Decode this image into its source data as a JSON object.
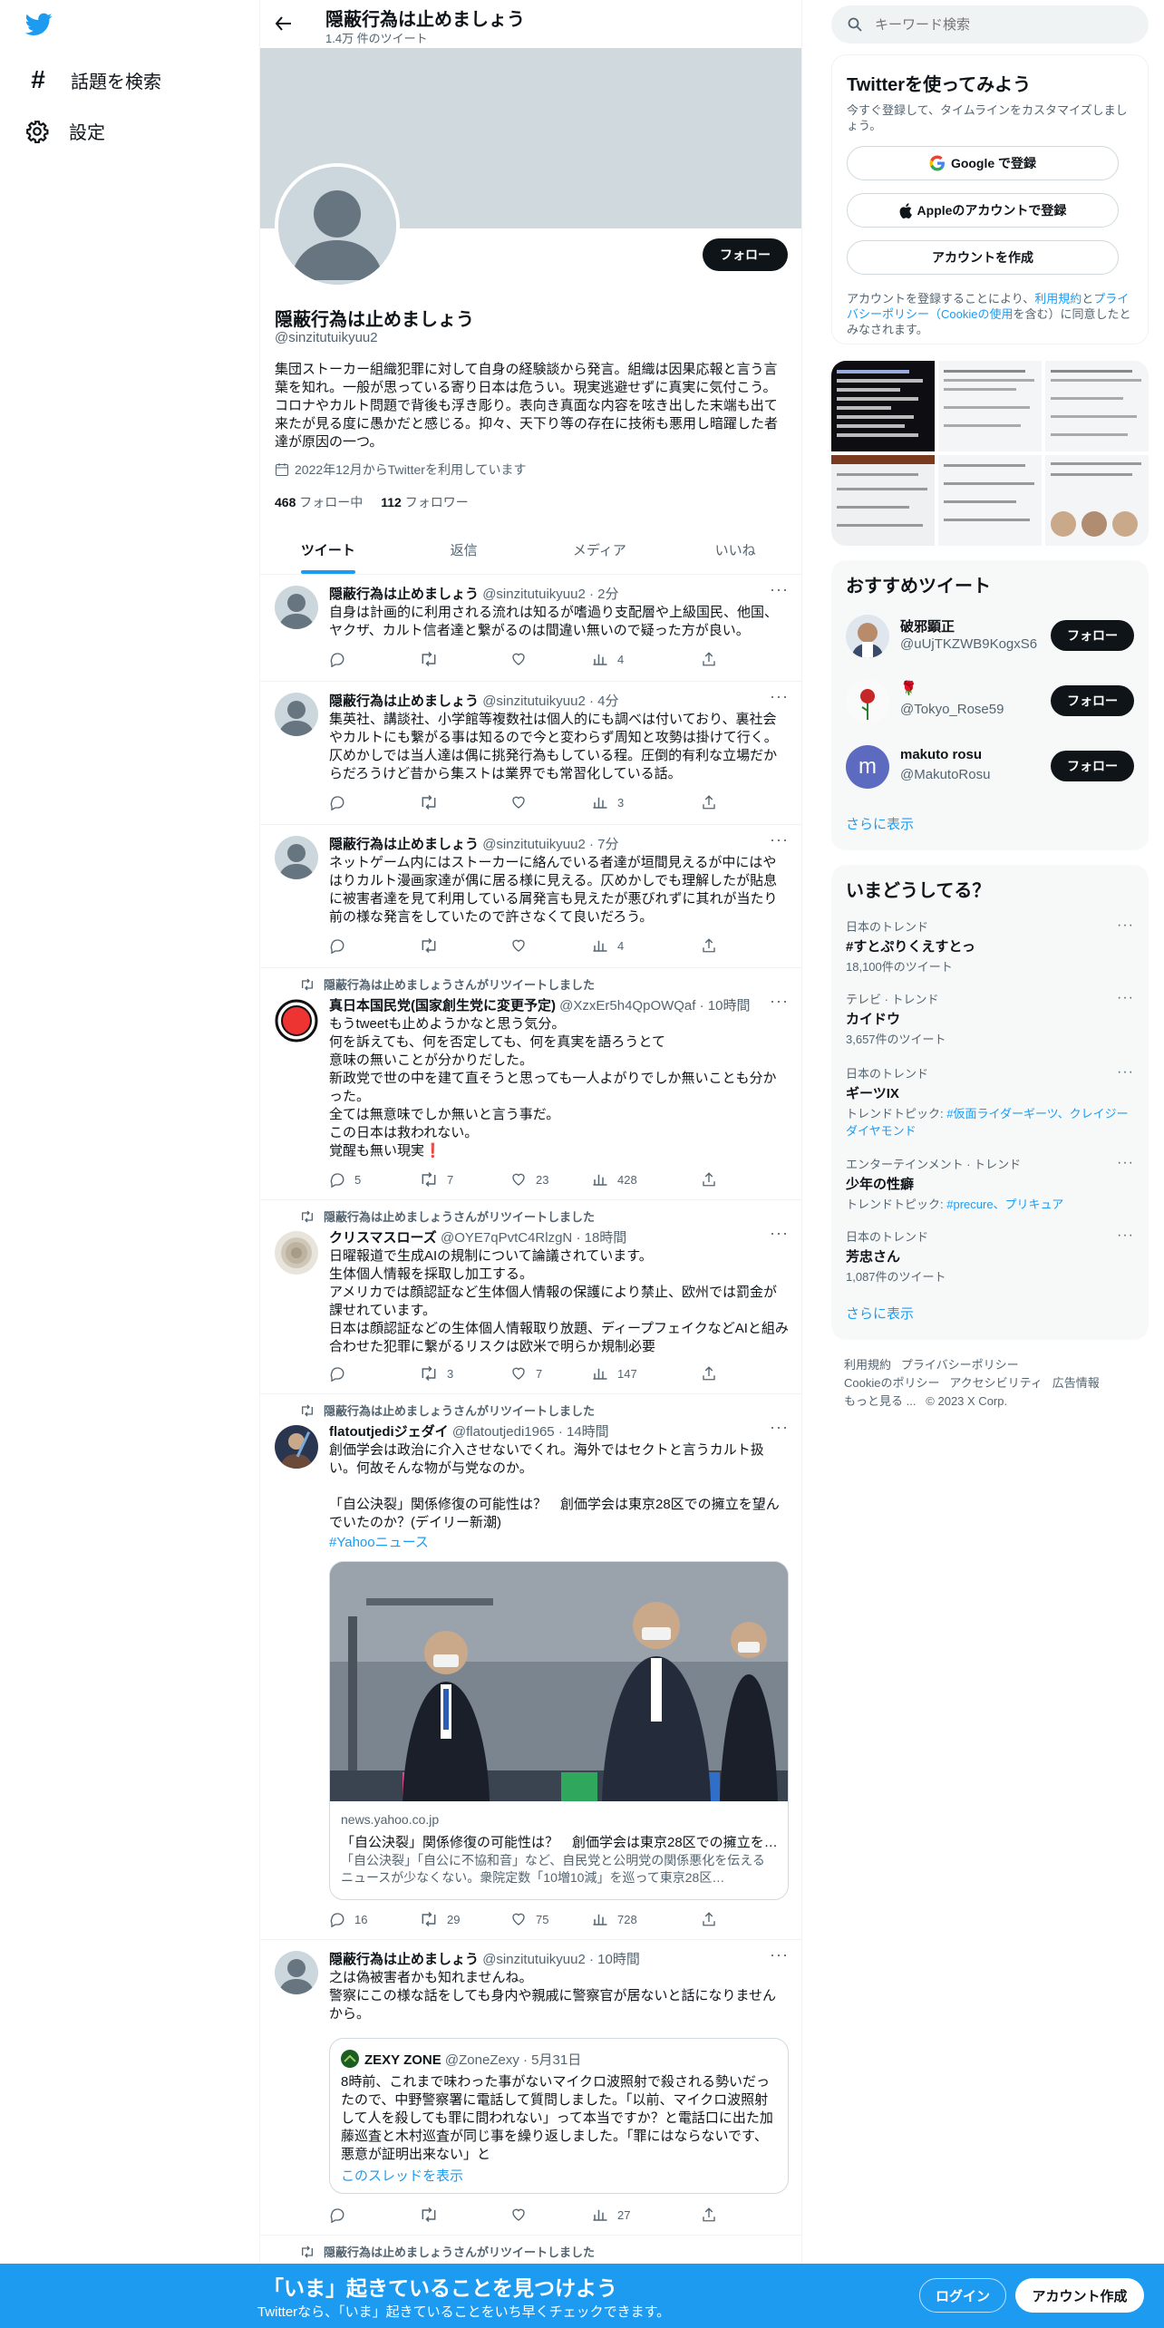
{
  "colors": {
    "accent": "#1d9bf0",
    "text": "#0f1419",
    "muted": "#536471",
    "banner": "#cfd9de"
  },
  "nav": {
    "logo": "twitter-bird-icon",
    "items": [
      {
        "label": "話題を検索",
        "icon": "hashtag-icon"
      },
      {
        "label": "設定",
        "icon": "gear-icon"
      }
    ]
  },
  "header": {
    "title": "隠蔽行為は止めましょう",
    "count": "1.4万 件のツイート"
  },
  "profile": {
    "name": "隠蔽行為は止めましょう",
    "handle": "@sinzitutuikyuu2",
    "follow_label": "フォロー",
    "bio": "集団ストーカー組織犯罪に対して自身の経験談から発言。組織は因果応報と言う言葉を知れ。一般が思っている寄り日本は危うい。現実逃避せずに真実に気付こう。コロナやカルト問題で背後も浮き彫り。表向き真面な内容を呟き出した末端も出て来たが見る度に愚かだと感じる。抑々、天下り等の存在に技術も悪用し暗躍した者達が原因の一つ。",
    "joined": "2022年12月からTwitterを利用しています",
    "following_count": "468",
    "following_label": "フォロー中",
    "followers_count": "112",
    "followers_label": "フォロワー"
  },
  "tabs": [
    {
      "label": "ツイート",
      "active": true
    },
    {
      "label": "返信"
    },
    {
      "label": "メディア"
    },
    {
      "label": "いいね"
    }
  ],
  "tweets": [
    {
      "name": "隠蔽行為は止めましょう",
      "handle": "@sinzitutuikyuu2",
      "time": "· 2分",
      "text": "自身は計画的に利用される流れは知るが嗜過り支配層や上級国民、他国、ヤクザ、カルト信者達と繋がるのは間違い無いので疑った方が良い。",
      "replies": "",
      "retweets": "",
      "likes": "",
      "views": "4"
    },
    {
      "name": "隠蔽行為は止めましょう",
      "handle": "@sinzitutuikyuu2",
      "time": "· 4分",
      "text": "集英社、講談社、小学館等複数社は個人的にも調べは付いており、裏社会やカルトにも繋がる事は知るので今と変わらず周知と攻勢は掛けて行く。仄めかしでは当人達は偶に挑発行為もしている程。圧倒的有利な立場だからだろうけど昔から集ストは業界でも常習化している話。",
      "replies": "",
      "retweets": "",
      "likes": "",
      "views": "3"
    },
    {
      "name": "隠蔽行為は止めましょう",
      "handle": "@sinzitutuikyuu2",
      "time": "· 7分",
      "text": "ネットゲーム内にはストーカーに絡んでいる者達が垣間見えるが中にはやはりカルト漫画家達が偶に居る様に見える。仄めかしでも理解したが貼息に被害者達を見て利用している屑発言も見えたが悪びれずに其れが当たり前の様な発言をしていたので許さなくて良いだろう。",
      "replies": "",
      "retweets": "",
      "likes": "",
      "views": "4"
    },
    {
      "retweeted_by": "隠蔽行為は止めましょうさんがリツイートしました",
      "name": "真日本国民党(国家創生党に変更予定)",
      "handle": "@XzxEr5h4QpOWQaf",
      "time": "· 10時間",
      "text": "もうtweetも止めようかなと思う気分。\n何を訴えても、何を否定しても、何を真実を語ろうとて\n意味の無いことが分かりだした。\n新政党で世の中を建て直そうと思っても一人よがりでしか無いことも分かった。\n全ては無意味でしか無いと言う事だ。\nこの日本は救われない。\n覚醒も無い現実❗",
      "replies": "5",
      "retweets": "7",
      "likes": "23",
      "views": "428"
    },
    {
      "retweeted_by": "隠蔽行為は止めましょうさんがリツイートしました",
      "name": "クリスマスローズ",
      "handle": "@OYE7qPvtC4RlzgN",
      "time": "· 18時間",
      "text": "日曜報道で生成AIの規制について論議されています。\n生体個人情報を採取し加工する。\nアメリカでは顔認証など生体個人情報の保護により禁止、欧州では罰金が課せれています。\n日本は顔認証などの生体個人情報取り放題、ディープフェイクなどAIと組み合わせた犯罪に繋がるリスクは欧米で明らか規制必要",
      "replies": "",
      "retweets": "3",
      "likes": "7",
      "views": "147"
    },
    {
      "retweeted_by": "隠蔽行為は止めましょうさんがリツイートしました",
      "name": "flatoutjediジェダイ",
      "handle": "@flatoutjedi1965",
      "time": "· 14時間",
      "text": "創価学会は政治に介入させないでくれ。海外ではセクトと言うカルト扱い。何故そんな物が与党なのか。\n\n「自公決裂」関係修復の可能性は？　創価学会は東京28区での擁立を望んでいたのか？(デイリー新潮)",
      "hashtag": "#Yahooニュース",
      "card": {
        "domain": "news.yahoo.co.jp",
        "title": "「自公決裂」関係修復の可能性は？　創価学会は東京28区での擁立を…",
        "desc": "「自公決裂」「自公に不協和音」など、自民党と公明党の関係悪化を伝えるニュースが少なくない。衆院定数「10増10減」を巡って東京28区…"
      },
      "replies": "16",
      "retweets": "29",
      "likes": "75",
      "views": "728"
    },
    {
      "name": "隠蔽行為は止めましょう",
      "handle": "@sinzitutuikyuu2",
      "time": "· 10時間",
      "text": "之は偽被害者かも知れませんね。\n警察にこの様な話をしても身内や親戚に警察官が居ないと話になりませんから。",
      "quote": {
        "name": "ZEXY ZONE",
        "handle": "@ZoneZexy",
        "time": "· 5月31日",
        "text": "8時前、これまで味わった事がないマイクロ波照射で殺される勢いだったので、中野警察署に電話して質問しました。「以前、マイクロ波照射して人を殺しても罪に問われない」って本当ですか？と電話口に出た加藤巡査と木村巡査が同じ事を繰り返しました。「罪にはならないです、悪意が証明出来ない」と",
        "thread": "このスレッドを表示"
      },
      "replies": "",
      "retweets": "",
      "likes": "",
      "views": "27"
    },
    {
      "retweeted_by": "隠蔽行為は止めましょうさんがリツイートしました"
    }
  ],
  "search": {
    "placeholder": "キーワード検索"
  },
  "signup": {
    "title": "Twitterを使ってみよう",
    "subtitle": "今すぐ登録して、タイムラインをカスタマイズしましょう。",
    "google": "Google で登録",
    "apple": "Appleのアカウントで登録",
    "create": "アカウントを作成",
    "terms_pre": "アカウントを登録することにより、",
    "terms_link1": "利用規約",
    "terms_mid1": "と",
    "terms_link2": "プライバシーポリシー（Cookieの使用",
    "terms_mid2": "を含む）に同意したとみなされます。"
  },
  "recommended": {
    "title": "おすすめツイート",
    "users": [
      {
        "name": "破邪顕正",
        "handle": "@uUjTKZWB9KogxS6",
        "follow": "フォロー"
      },
      {
        "name": "🌹",
        "handle": "@Tokyo_Rose59",
        "follow": "フォロー"
      },
      {
        "name": "makuto rosu",
        "handle": "@MakutoRosu",
        "follow": "フォロー",
        "initial": "m"
      }
    ],
    "more": "さらに表示"
  },
  "trends": {
    "title": "いまどうしてる？",
    "items": [
      {
        "cat": "日本のトレンド",
        "title": "#すとぷりくえすとっ",
        "sub": "18,100件のツイート"
      },
      {
        "cat": "テレビ · トレンド",
        "title": "カイドウ",
        "sub": "3,657件のツイート"
      },
      {
        "cat": "日本のトレンド",
        "title": "ギーツIX",
        "sub_pre": "トレンドトピック: ",
        "sub_link": "#仮面ライダーギーツ、クレイジーダイヤモンド"
      },
      {
        "cat": "エンターテインメント · トレンド",
        "title": "少年の性癖",
        "sub_pre": "トレンドトピック: ",
        "sub_link": "#precure、プリキュア"
      },
      {
        "cat": "日本のトレンド",
        "title": "芳忠さん",
        "sub": "1,087件のツイート"
      }
    ],
    "more": "さらに表示"
  },
  "footer": {
    "links": [
      "利用規約",
      "プライバシーポリシー",
      "Cookieのポリシー",
      "アクセシビリティ",
      "広告情報",
      "もっと見る ...",
      "© 2023 X Corp."
    ]
  },
  "bottombar": {
    "title": "「いま」起きていることを見つけよう",
    "subtitle": "Twitterなら、「いま」起きていることをいち早くチェックできます。",
    "login": "ログイン",
    "signup": "アカウント作成"
  }
}
